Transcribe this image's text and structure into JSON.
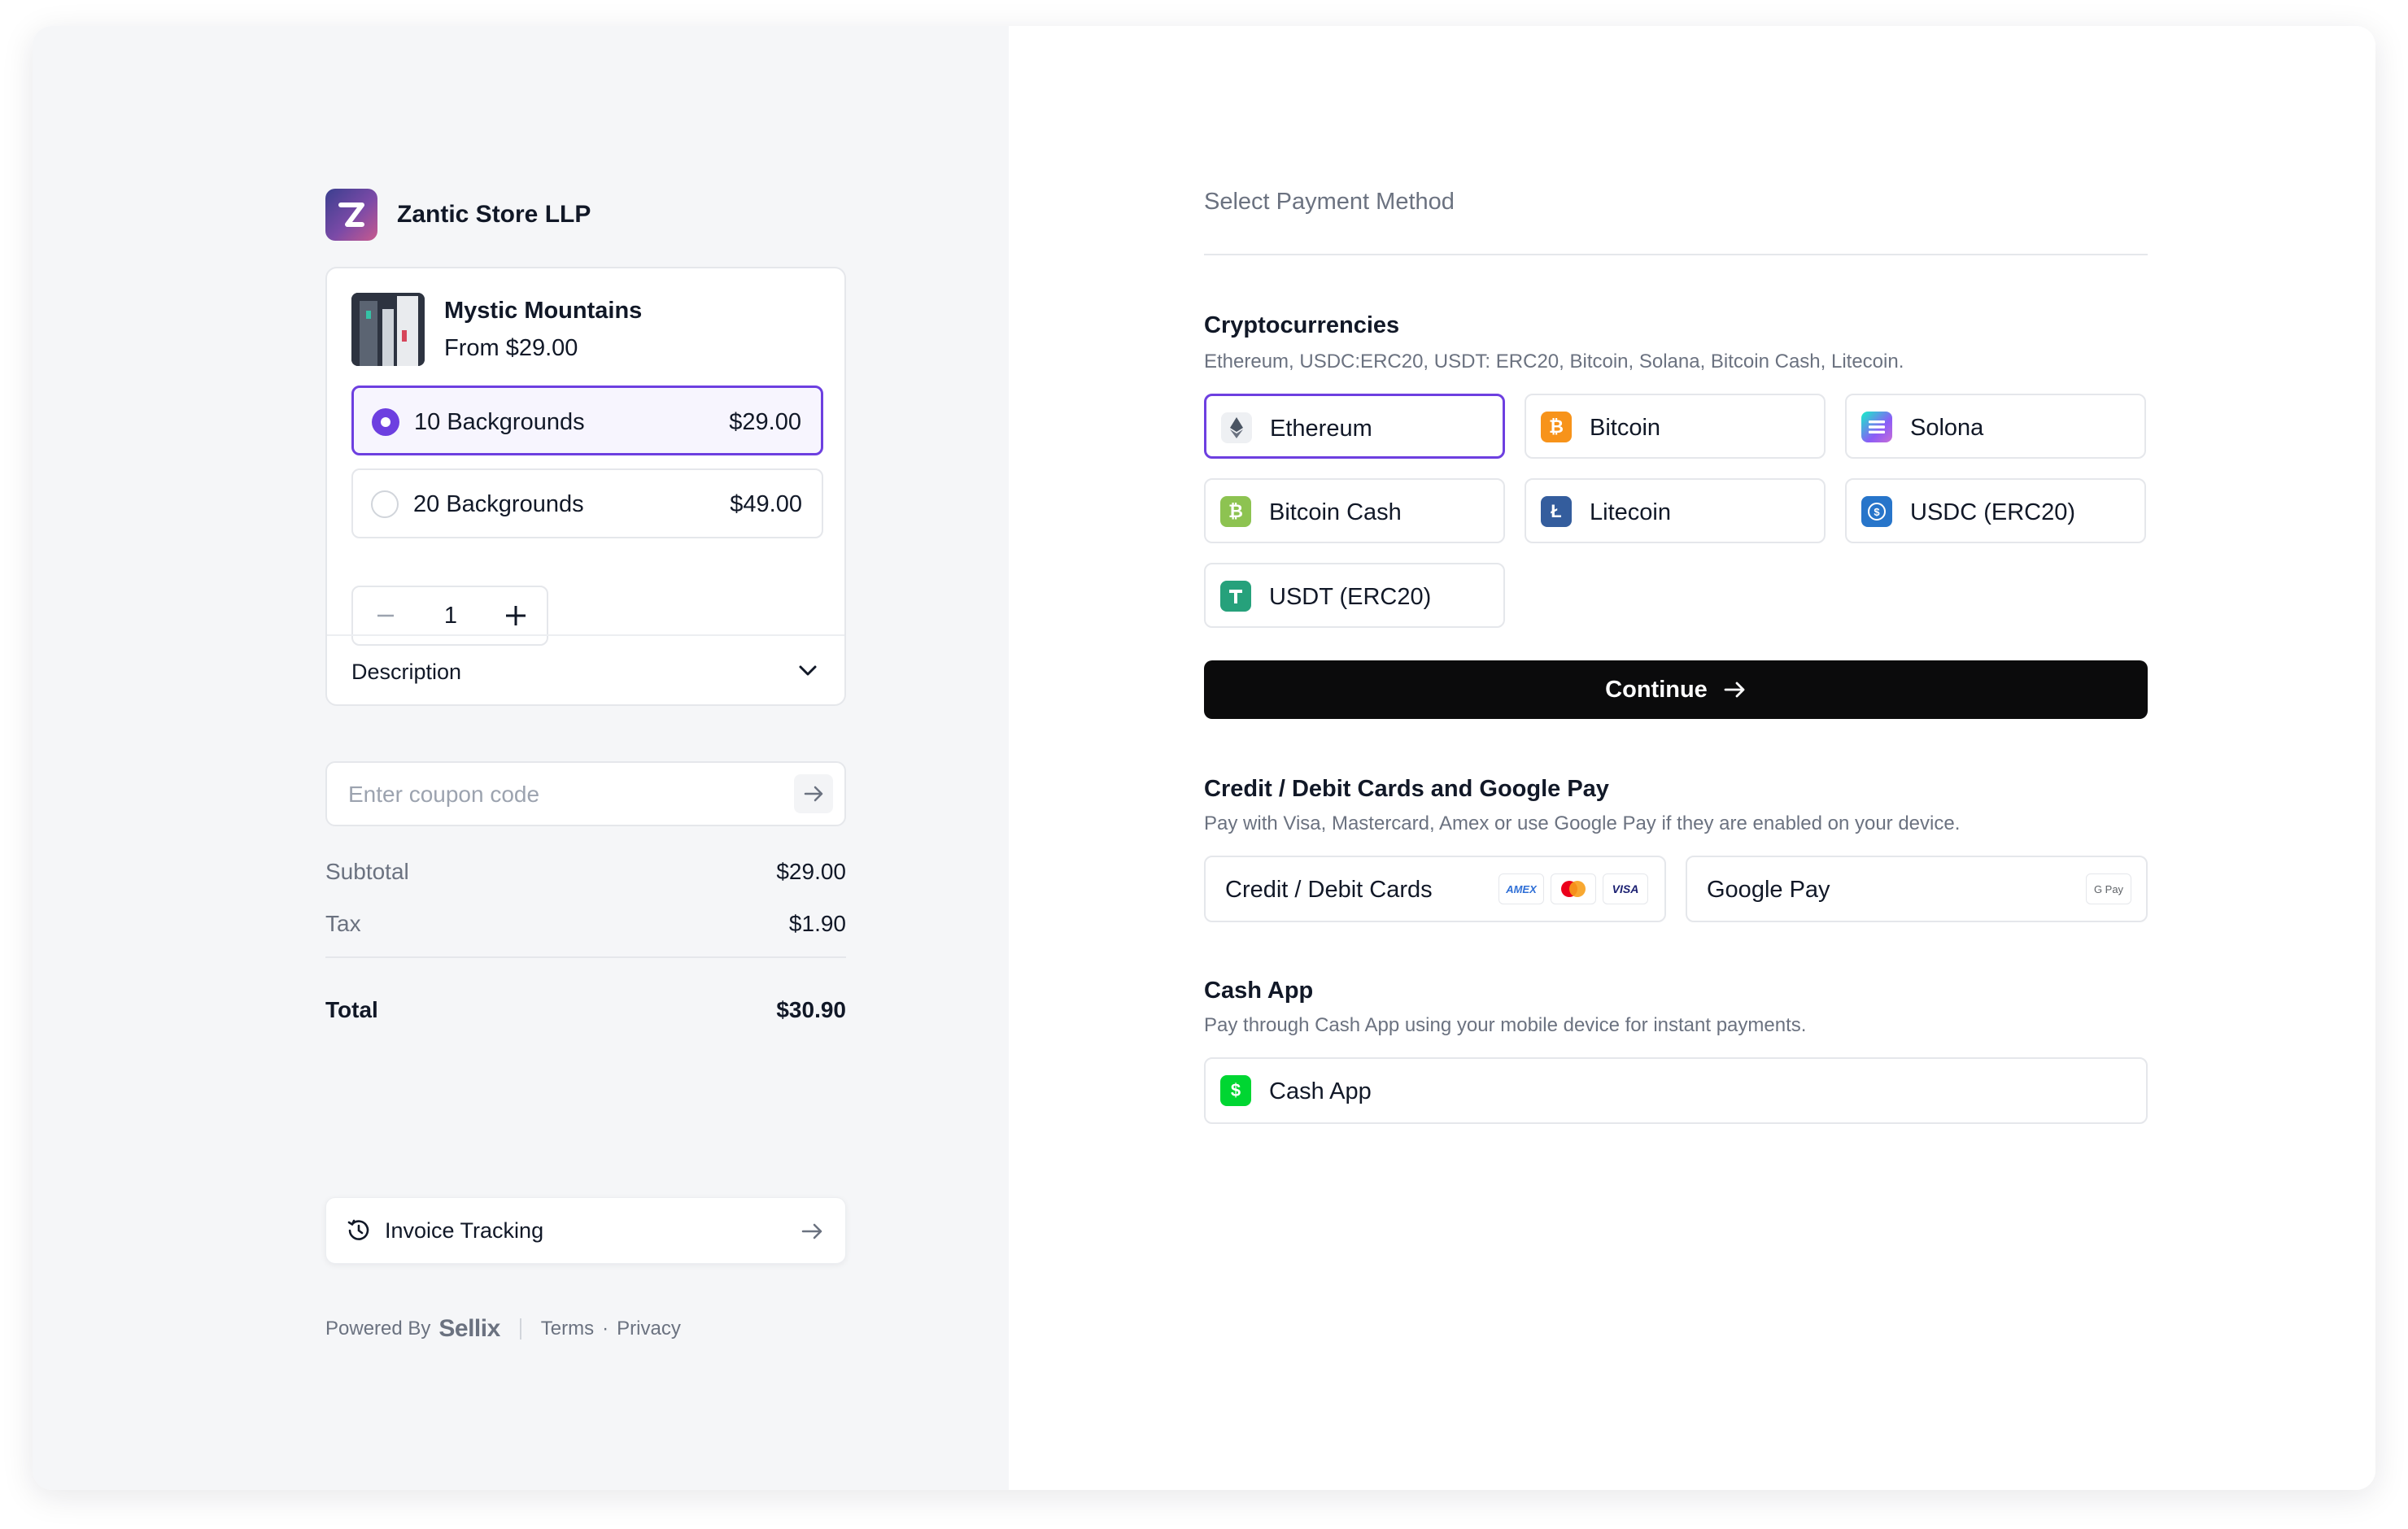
{
  "store": {
    "name": "Zantic Store LLP"
  },
  "product": {
    "name": "Mystic Mountains",
    "price_from": "From $29.00"
  },
  "variants": [
    {
      "label": "10 Backgrounds",
      "price": "$29.00",
      "selected": true
    },
    {
      "label": "20 Backgrounds",
      "price": "$49.00",
      "selected": false
    }
  ],
  "quantity": {
    "value": "1"
  },
  "description": {
    "label": "Description"
  },
  "coupon": {
    "placeholder": "Enter coupon code"
  },
  "summary": {
    "subtotal_label": "Subtotal",
    "subtotal": "$29.00",
    "tax_label": "Tax",
    "tax": "$1.90",
    "total_label": "Total",
    "total": "$30.90"
  },
  "invoice": {
    "label": "Invoice Tracking"
  },
  "footer": {
    "powered_by": "Powered By",
    "brand": "Sellix",
    "terms": "Terms",
    "dot": "·",
    "privacy": "Privacy"
  },
  "payment": {
    "title": "Select Payment Method",
    "crypto": {
      "title": "Cryptocurrencies",
      "subtitle": "Ethereum, USDC:ERC20, USDT: ERC20, Bitcoin, Solana, Bitcoin Cash, Litecoin.",
      "options": [
        {
          "label": "Ethereum",
          "icon": "ethereum-icon",
          "color": "#eef0f3",
          "selected": true
        },
        {
          "label": "Bitcoin",
          "icon": "bitcoin-icon",
          "color": "#f7931a"
        },
        {
          "label": "Solona",
          "icon": "solana-icon",
          "color": "#8b5cf6"
        },
        {
          "label": "Bitcoin Cash",
          "icon": "bitcoin-cash-icon",
          "color": "#8dc351"
        },
        {
          "label": "Litecoin",
          "icon": "litecoin-icon",
          "color": "#345d9d"
        },
        {
          "label": "USDC (ERC20)",
          "icon": "usdc-icon",
          "color": "#2775ca"
        },
        {
          "label": "USDT (ERC20)",
          "icon": "usdt-icon",
          "color": "#26a17b"
        }
      ]
    },
    "continue_label": "Continue",
    "cards": {
      "title": "Credit / Debit Cards and Google Pay",
      "subtitle": "Pay with Visa, Mastercard, Amex or use Google Pay if they are enabled on your device.",
      "card_label": "Credit / Debit Cards",
      "card_brands": [
        "AMEX",
        "Mastercard",
        "VISA"
      ],
      "gpay_label": "Google Pay",
      "gpay_badge": "G Pay"
    },
    "cashapp": {
      "title": "Cash App",
      "subtitle": "Pay through Cash App using your mobile device for instant payments.",
      "label": "Cash App",
      "color": "#00d632"
    }
  },
  "colors": {
    "accent": "#6d3fe0",
    "button": "#0b0b0c"
  }
}
